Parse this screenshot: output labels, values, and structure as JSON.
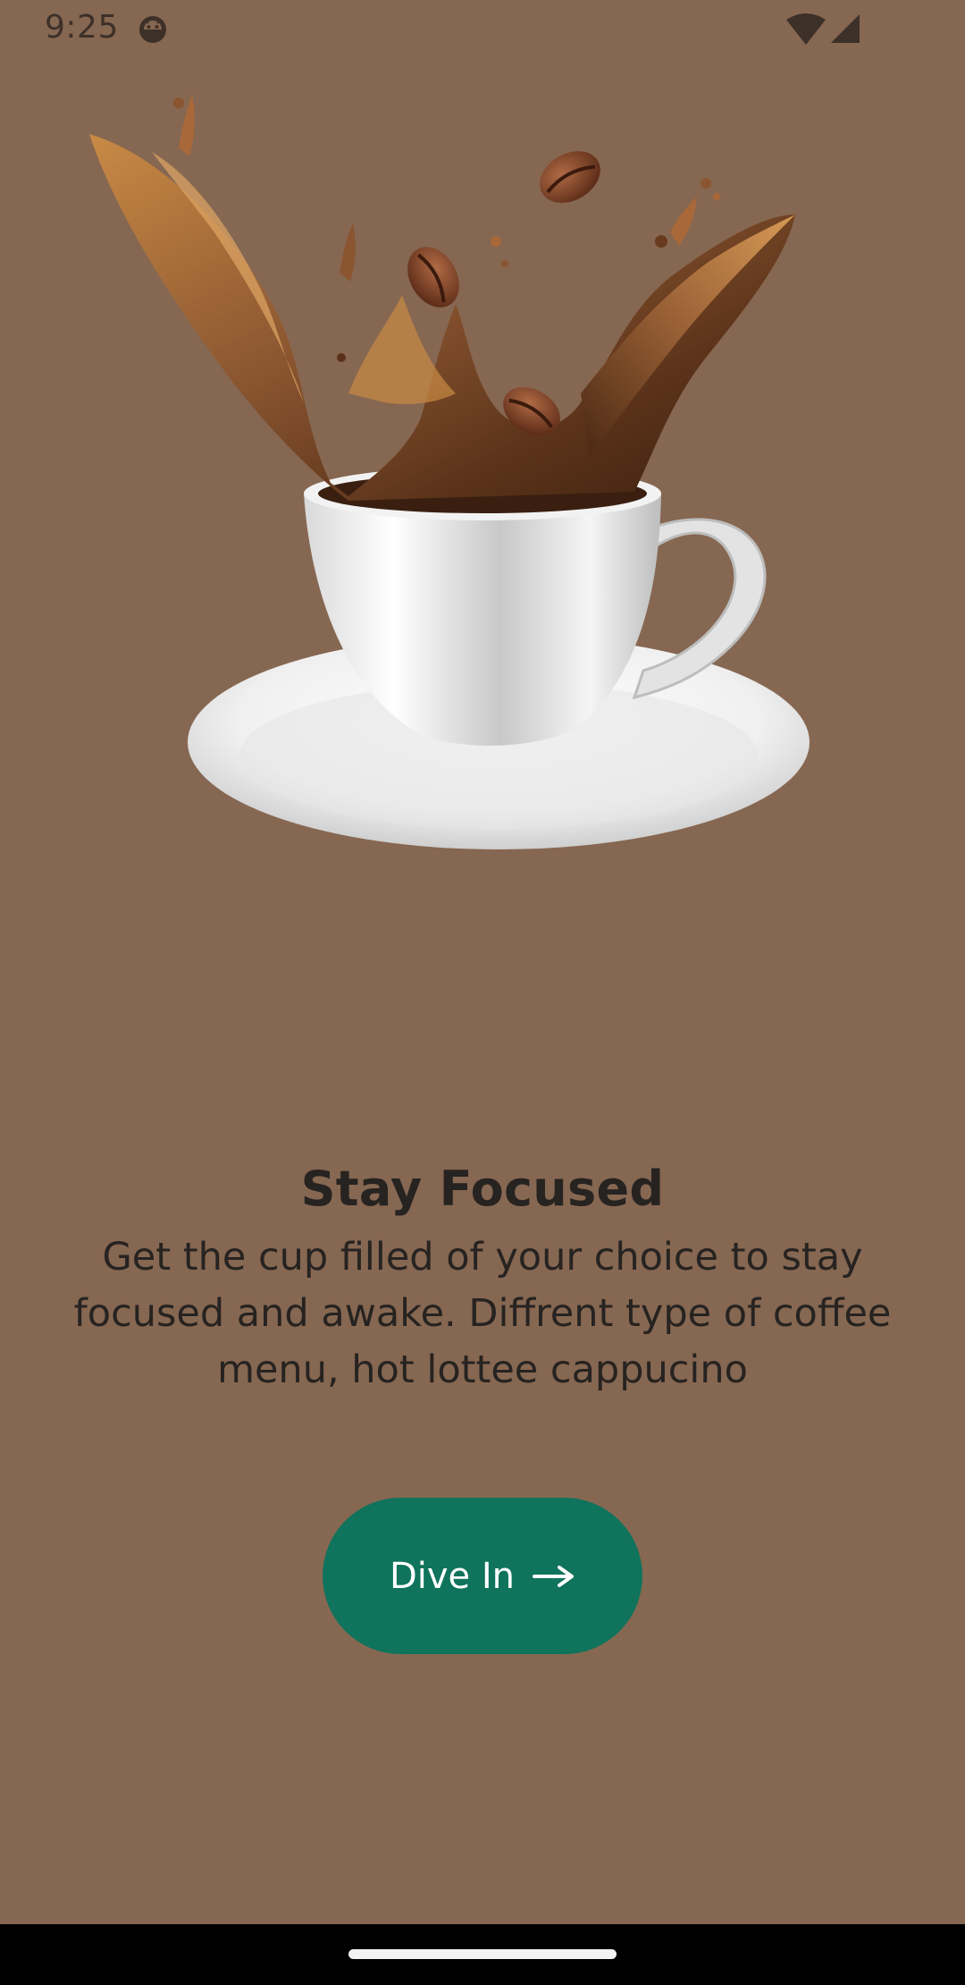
{
  "status_bar": {
    "time": "9:25",
    "notification_icon": "android-face-icon",
    "wifi_icon": "wifi-icon",
    "signal_icon": "cellular-signal-icon"
  },
  "hero": {
    "icon": "coffee-cup-splash-illustration"
  },
  "onboarding": {
    "title": "Stay Focused",
    "description": "Get the cup filled of your choice to stay focused and awake. Diffrent type of coffee menu, hot lottee cappucino"
  },
  "cta": {
    "label": "Dive In",
    "icon": "arrow-right-icon"
  },
  "colors": {
    "background": "#866751",
    "button": "#10735c",
    "text": "#262321"
  }
}
